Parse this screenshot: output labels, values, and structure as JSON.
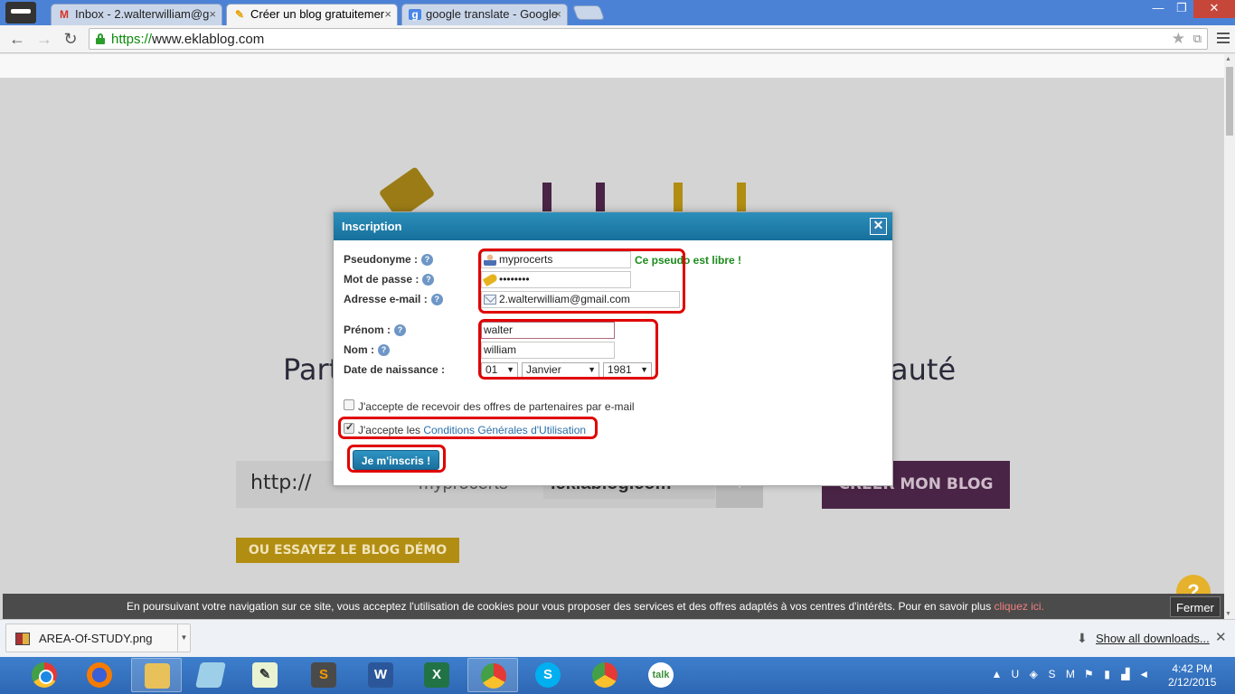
{
  "browser": {
    "tabs": [
      {
        "favicon": "gmail-icon",
        "title": "Inbox - 2.walterwilliam@g",
        "active": false
      },
      {
        "favicon": "pencil-icon",
        "title": "Créer un blog gratuitemer",
        "active": true
      },
      {
        "favicon": "google-icon",
        "title": "google translate - Google",
        "active": false
      }
    ],
    "url_scheme": "https://",
    "url_rest": "www.eklablog.com"
  },
  "page": {
    "hero_left": "Part",
    "hero_right": "auté",
    "url_prefix": "http://",
    "url_name": "myprocerts",
    "url_domain": ".eklablog.com",
    "create_button": "CRÉER MON BLOG",
    "demo_button": "OU ESSAYEZ LE BLOG DÉMO",
    "help_bubble": "?"
  },
  "modal": {
    "title": "Inscription",
    "close": "✕",
    "fields": {
      "pseudo_label": "Pseudonyme :",
      "pseudo_value": "myprocerts",
      "pseudo_status": "Ce pseudo est libre !",
      "password_label": "Mot de passe :",
      "password_value": "••••••••",
      "email_label": "Adresse e-mail :",
      "email_value": "2.walterwilliam@gmail.com",
      "firstname_label": "Prénom :",
      "firstname_value": "walter",
      "lastname_label": "Nom :",
      "lastname_value": "william",
      "birthdate_label": "Date de naissance :",
      "birth_day": "01",
      "birth_month": "Janvier",
      "birth_year": "1981"
    },
    "help_glyph": "?",
    "offers_checkbox": {
      "label": "J'accepte de recevoir des offres de partenaires par e-mail",
      "checked": false
    },
    "terms_checkbox": {
      "label_prefix": "J'accepte les ",
      "link": "Conditions Générales d'Utilisation",
      "checked": true
    },
    "submit": "Je m'inscris !"
  },
  "cookie_bar": {
    "text": "En poursuivant votre navigation sur ce site, vous acceptez l'utilisation de cookies pour vous proposer des services et des offres adaptés à vos centres d'intérêts. Pour en savoir plus ",
    "link": "cliquez ici.",
    "close": "Fermer"
  },
  "downloads": {
    "file": "AREA-Of-STUDY.png",
    "show_all": "Show all downloads..."
  },
  "taskbar": {
    "apps": [
      "chrome-user",
      "firefox",
      "file-explorer",
      "notepad",
      "editor",
      "sublime-text",
      "word",
      "excel",
      "chrome",
      "skype",
      "chrome-user-2",
      "google-talk"
    ],
    "tray_icons": [
      "up-arrow-icon",
      "upwork-icon",
      "network-icon",
      "skype-tray-icon",
      "gmail-tray-icon",
      "flag-icon",
      "battery-icon",
      "signal-icon",
      "volume-icon"
    ],
    "time": "4:42 PM",
    "date": "2/12/2015"
  },
  "colors": {
    "accent_blue": "#1a7fb0",
    "highlight_red": "#e00000",
    "status_green": "#1c8a1c"
  }
}
